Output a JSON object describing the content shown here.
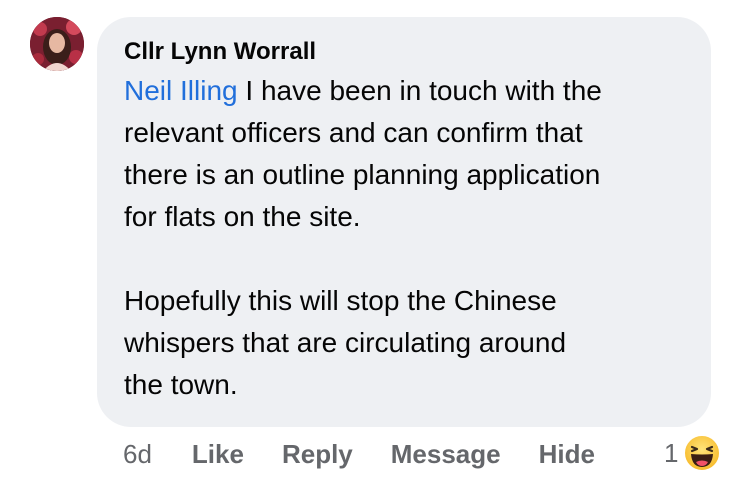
{
  "comment": {
    "author": "Cllr Lynn Worrall",
    "mention": "Neil Illing",
    "paragraph1": [
      " I have been in touch with the",
      "relevant officers and can confirm that",
      "there is an outline planning application",
      "for flats on the site."
    ],
    "paragraph2": [
      "Hopefully this will stop the Chinese",
      "whispers that are circulating around",
      "the town."
    ]
  },
  "actions": {
    "time": "6d",
    "like": "Like",
    "reply": "Reply",
    "message": "Message",
    "hide": "Hide"
  },
  "reaction": {
    "count": "1",
    "icon": "laughing-emoji-icon"
  }
}
